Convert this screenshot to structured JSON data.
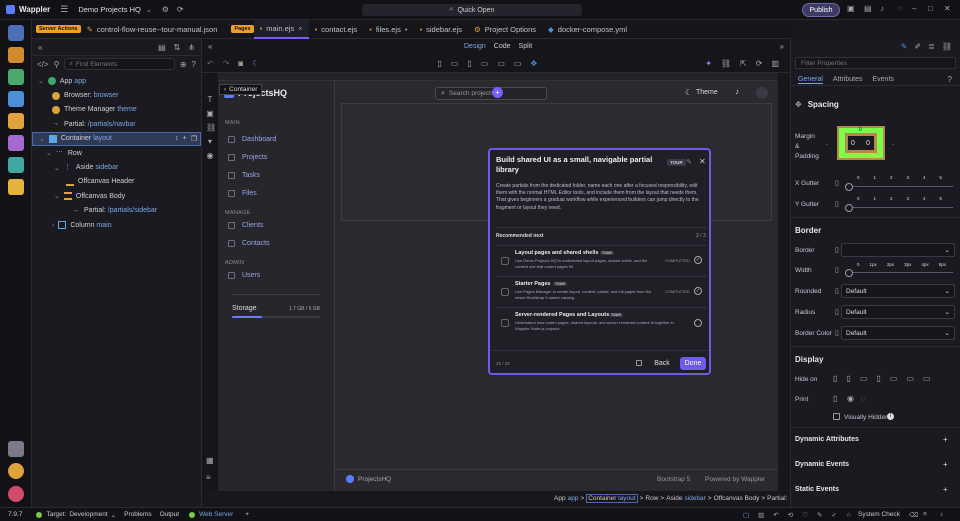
{
  "app": {
    "name": "Wappler",
    "project": "Demo Projects HQ",
    "quick_open": "Quick Open",
    "publish": "Publish"
  },
  "tabs": {
    "server_actions": "Server Actions",
    "items": [
      {
        "label": "control-flow-reuse--tour-manual.json"
      },
      {
        "badge": "Pages",
        "label": "main.ejs",
        "active": true
      },
      {
        "label": "contact.ejs"
      },
      {
        "label": "files.ejs"
      },
      {
        "label": "sidebar.ejs"
      },
      {
        "label": "Project Options"
      },
      {
        "label": "docker-compose.yml"
      }
    ]
  },
  "view_modes": {
    "design": "Design",
    "code": "Code",
    "split": "Split"
  },
  "tree": {
    "search_placeholder": "Find Elements",
    "items": [
      {
        "label": "App",
        "sub": "app"
      },
      {
        "label": "Browser:",
        "sub": "browser"
      },
      {
        "label": "Theme Manager",
        "sub": "theme"
      },
      {
        "label": "Partial:",
        "sub": "/partials/navbar"
      },
      {
        "label": "Container",
        "sub": "layout"
      },
      {
        "label": "Row",
        "sub": ""
      },
      {
        "label": "Aside",
        "sub": "sidebar"
      },
      {
        "label": "Offcanvas Header",
        "sub": ""
      },
      {
        "label": "Offcanvas Body",
        "sub": ""
      },
      {
        "label": "Partial:",
        "sub": "/partials/sidebar"
      },
      {
        "label": "Column",
        "sub": "main"
      }
    ]
  },
  "canvas": {
    "container_tag": "Container",
    "brand": "ProjectsHQ",
    "search_placeholder": "Search projects",
    "theme_label": "Theme",
    "sections": {
      "main": "MAIN",
      "manage": "MANAGE",
      "admin": "ADMIN"
    },
    "nav": {
      "dashboard": "Dashboard",
      "projects": "Projects",
      "tasks": "Tasks",
      "files": "Files",
      "clients": "Clients",
      "contacts": "Contacts",
      "users": "Users"
    },
    "storage": {
      "label": "Storage",
      "value": "1.7 GB / 5 GB",
      "fraction": 0.34
    },
    "footer": {
      "brand": "ProjectsHQ",
      "framework": "Bootstrap 5",
      "powered": "Powered by Wappler"
    }
  },
  "modal": {
    "title": "Build shared UI as a small, navigable partial library",
    "tag": "TOUR",
    "description": "Create partials from the dedicated folder, name each one after a focused responsibility, edit them with the normal HTML Editor tools, and include them from the layout that needs them. That gives beginners a gradual workflow while experienced builders can jump directly to the fragment or layout they need.",
    "recommended": "Recommended next",
    "count": "2 / 3",
    "items": [
      {
        "title": "Layout pages and shared shells",
        "tag": "TOUR",
        "desc": "Use Demo Projects HQ to understand layout pages, shared shells, and the content slot that routed pages fill.",
        "status": "COMPLETED"
      },
      {
        "title": "Starter Pages",
        "tag": "TOUR",
        "desc": "Use Pages Manager to create layout, content, partial, and full pages from the newer Bootstrap 5 starter catalog.",
        "status": "COMPLETED"
      },
      {
        "title": "Server-rendered Pages and Layouts",
        "tag": "TOUR",
        "desc": "Understand how routed pages, shared layouts, and server-rendered content fit together in Wappler Node.js projects.",
        "status": ""
      }
    ],
    "step": "25 / 25",
    "back": "Back",
    "done": "Done"
  },
  "breadcrumb": {
    "app": "App",
    "app_sub": "app",
    "container": "Container",
    "container_sub": "layout",
    "row": "Row",
    "aside": "Aside",
    "aside_sub": "sidebar",
    "offcanvas": "Offcanvas Body",
    "partial": "Partial:"
  },
  "right": {
    "filter_placeholder": "Filter Properties",
    "tabs": {
      "general": "General",
      "attributes": "Attributes",
      "events": "Events"
    },
    "spacing": "Spacing",
    "margin_label": "Margin & Padding",
    "box": {
      "m": "0",
      "p1": "0",
      "p2": "0"
    },
    "ticks": [
      "0",
      "1",
      "2",
      "3",
      "4",
      "5"
    ],
    "x_gutter": "X Gutter",
    "y_gutter": "Y Gutter",
    "border_title": "Border",
    "border": "Border",
    "width": "Width",
    "width_ticks": [
      "0",
      "1px",
      "2px",
      "3px",
      "4px",
      "5px"
    ],
    "rounded": "Rounded",
    "radius": "Radius",
    "border_color": "Border Color",
    "default": "Default",
    "display_title": "Display",
    "hide_on": "Hide on",
    "print": "Print",
    "visually_hidden": "Visually Hidden",
    "dyn_attr": "Dynamic Attributes",
    "dyn_events": "Dynamic Events",
    "static_events": "Static Events"
  },
  "status": {
    "version": "7.9.7",
    "target_label": "Target:",
    "target": "Development",
    "problems": "Problems",
    "output": "Output",
    "web_server": "Web Server",
    "system_check": "System Check"
  }
}
